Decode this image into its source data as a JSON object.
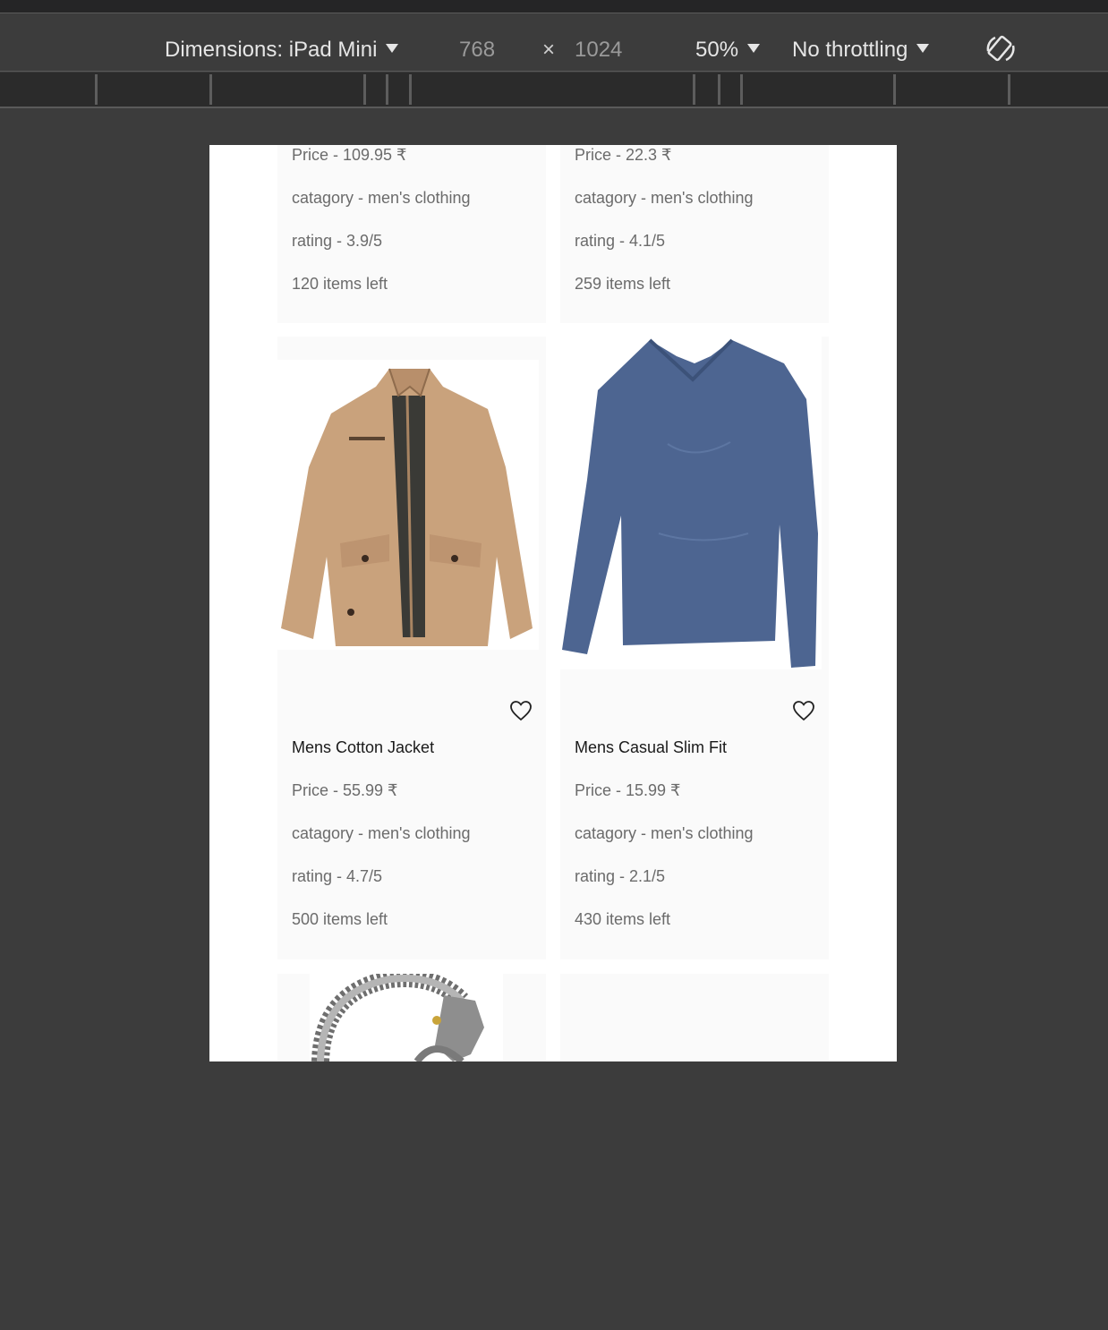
{
  "devtools": {
    "dimensions_label": "Dimensions: iPad Mini",
    "width_value": "768",
    "times_symbol": "×",
    "height_value": "1024",
    "zoom_label": "50%",
    "throttling_label": "No throttling",
    "rotate_icon": "rotate-device-icon"
  },
  "products": {
    "top_row": [
      {
        "price": "Price - 109.95 ₹",
        "category": "catagory - men's clothing",
        "rating": "rating - 3.9/5",
        "stock": "120 items left"
      },
      {
        "price": "Price - 22.3 ₹",
        "category": "catagory - men's clothing",
        "rating": "rating - 4.1/5",
        "stock": "259 items left"
      }
    ],
    "middle_row": [
      {
        "title": "Mens Cotton Jacket",
        "price": "Price - 55.99 ₹",
        "category": "catagory - men's clothing",
        "rating": "rating - 4.7/5",
        "stock": "500 items left",
        "image": "khaki cotton jacket"
      },
      {
        "title": "Mens Casual Slim Fit",
        "price": "Price - 15.99 ₹",
        "category": "catagory - men's clothing",
        "rating": "rating - 2.1/5",
        "stock": "430 items left",
        "image": "blue long sleeve v-neck shirt"
      }
    ],
    "bottom_row": [
      {
        "image": "silver dragon chain bracelet"
      },
      {
        "image": ""
      }
    ]
  },
  "colors": {
    "devtools_bg": "#3c3c3c",
    "card_bg": "#fafafa",
    "text_muted": "#6b6b6b",
    "text_title": "#1a1a1a"
  }
}
